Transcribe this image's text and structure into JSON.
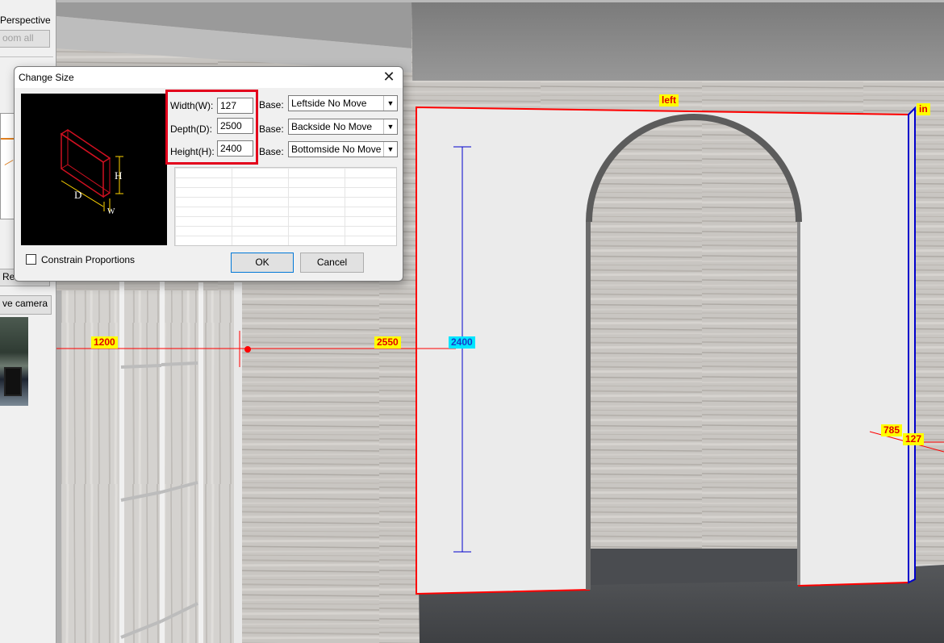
{
  "left_panel": {
    "perspective_label": "Perspective",
    "zoom_all_button": "oom all",
    "refresh_button": "Refresh",
    "save_camera_button": "ve camera"
  },
  "dialog": {
    "title": "Change Size",
    "close_icon": "close-icon",
    "width_label": "Width(W):",
    "width_value": "127",
    "depth_label": "Depth(D):",
    "depth_value": "2500",
    "height_label": "Height(H):",
    "height_value": "2400",
    "base_label": "Base:",
    "base_width": "Leftside No Move",
    "base_depth": "Backside No Move",
    "base_height": "Bottomside No Move",
    "preview_labels": {
      "h": "H",
      "d": "D",
      "w": "W"
    },
    "constrain_label": "Constrain Proportions",
    "ok_label": "OK",
    "cancel_label": "Cancel",
    "highlight_color": "#e3001b"
  },
  "viewport": {
    "dim_1200": "1200",
    "dim_2550": "2550",
    "dim_2400": "2400",
    "dim_785": "785",
    "dim_127": "127",
    "face_left": "left",
    "face_in": "in"
  },
  "colors": {
    "dim_label_bg": "#ffff00",
    "dim_label_text": "#e00000",
    "selection_red": "#ff0000",
    "axis_blue": "#0000cc",
    "height_label_bg": "#00e5ff"
  }
}
